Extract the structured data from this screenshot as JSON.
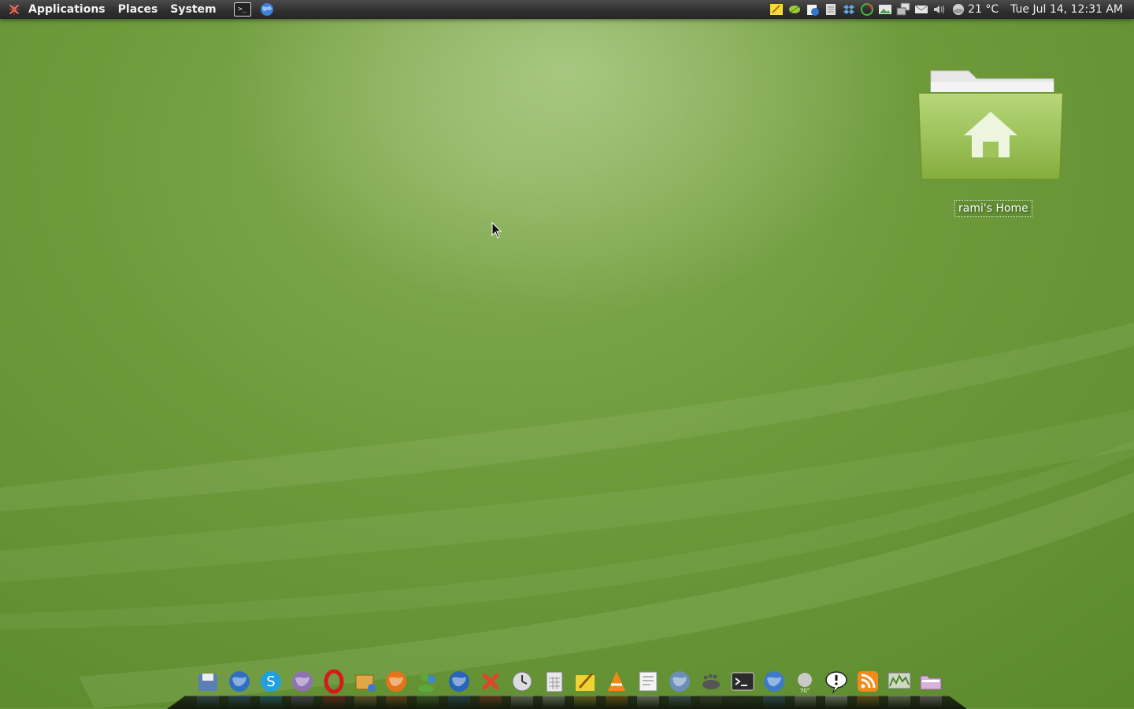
{
  "panel": {
    "menus": [
      {
        "label": "Applications"
      },
      {
        "label": "Places"
      },
      {
        "label": "System"
      }
    ],
    "launchers": [
      {
        "icon": "terminal-icon",
        "glyph": ">_"
      },
      {
        "icon": "globe-icon"
      }
    ],
    "tray": {
      "icons": [
        "notes-icon",
        "leaf-icon",
        "update-icon",
        "printer-icon",
        "dropbox-icon",
        "spiral-icon",
        "image-icon",
        "network-icon",
        "mail-icon",
        "volume-icon"
      ],
      "weather_icon": "weather-icon",
      "temperature": "21 °C",
      "clock": "Tue Jul 14, 12:31 AM"
    }
  },
  "desktop": {
    "home_icon": {
      "label": "rami's Home",
      "icon": "home-folder-icon",
      "color": "#9cc35a"
    }
  },
  "dock": {
    "items": [
      {
        "icon": "disk-utility-icon",
        "color": "#5a7fb3"
      },
      {
        "icon": "thunderbird-icon",
        "color": "#2f6fc2"
      },
      {
        "icon": "skype-icon",
        "color": "#1ea1e0"
      },
      {
        "icon": "pidgin-icon",
        "color": "#8e72b5"
      },
      {
        "icon": "opera-icon",
        "color": "#d61a1a"
      },
      {
        "icon": "package-manager-icon",
        "color": "#e0a846"
      },
      {
        "icon": "firefox-icon",
        "color": "#e4731a"
      },
      {
        "icon": "contacts-icon",
        "color": "#5ca83a"
      },
      {
        "icon": "google-earth-icon",
        "color": "#2a64b8"
      },
      {
        "icon": "close-x-icon",
        "color": "#e2442a"
      },
      {
        "icon": "clock-app-icon",
        "color": "#dcdcdc"
      },
      {
        "icon": "calculator-icon",
        "color": "#e8e8e8"
      },
      {
        "icon": "sticky-notes-icon",
        "color": "#f2d233"
      },
      {
        "icon": "vlc-icon",
        "color": "#f08a12"
      },
      {
        "icon": "text-editor-icon",
        "color": "#f4f4f4"
      },
      {
        "icon": "gimp-icon",
        "color": "#6b8fb9"
      },
      {
        "icon": "gnome-foot-icon",
        "color": "#555555"
      },
      {
        "icon": "terminal-icon",
        "color": "#2b2b2b"
      },
      {
        "icon": "browser-globe-icon",
        "color": "#3d7ac8"
      },
      {
        "icon": "weather-applet-icon",
        "color": "#c9c9c9"
      },
      {
        "icon": "chat-bubble-icon",
        "color": "#ffffff"
      },
      {
        "icon": "rss-icon",
        "color": "#f48a1c"
      },
      {
        "icon": "system-monitor-icon",
        "color": "#cfd9c4"
      },
      {
        "icon": "file-manager-icon",
        "color": "#d9b2dc"
      }
    ]
  }
}
